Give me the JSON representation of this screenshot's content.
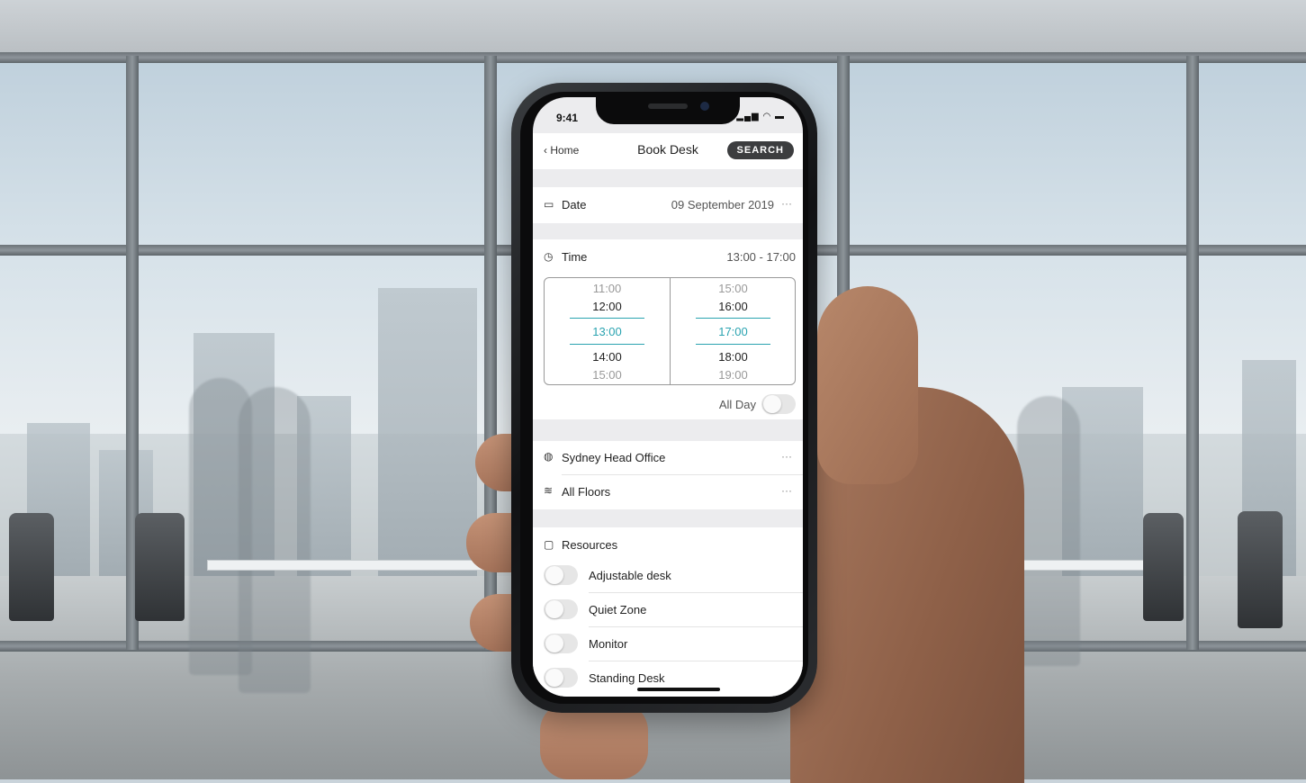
{
  "status": {
    "time": "9:41",
    "icons": "signal-wifi-battery"
  },
  "nav": {
    "back_label": "Home",
    "title": "Book Desk",
    "search_label": "SEARCH"
  },
  "date": {
    "label": "Date",
    "value": "09 September 2019",
    "more": "···"
  },
  "time_section": {
    "label": "Time",
    "value": "13:00 - 17:00",
    "start_column": [
      "11:00",
      "12:00",
      "13:00",
      "14:00",
      "15:00"
    ],
    "end_column": [
      "15:00",
      "16:00",
      "17:00",
      "18:00",
      "19:00"
    ],
    "selected_start": "13:00",
    "selected_end": "17:00",
    "all_day_label": "All Day",
    "all_day_on": false
  },
  "location": {
    "office": "Sydney Head Office",
    "floors": "All Floors",
    "more": "···"
  },
  "resources": {
    "label": "Resources",
    "items": [
      {
        "label": "Adjustable desk",
        "on": false
      },
      {
        "label": "Quiet Zone",
        "on": false
      },
      {
        "label": "Monitor",
        "on": false
      },
      {
        "label": "Standing Desk",
        "on": false
      }
    ]
  },
  "colors": {
    "accent": "#2aa3b0",
    "button": "#3c3d3f"
  }
}
